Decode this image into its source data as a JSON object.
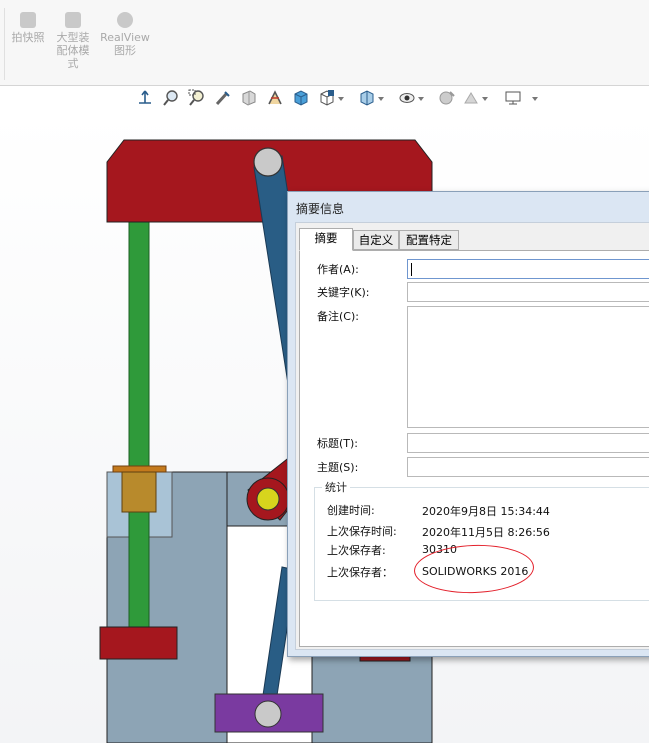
{
  "ribbon": {
    "items": [
      {
        "label": "拍快照",
        "icon": "camera-icon"
      },
      {
        "label": "大型装配体模式",
        "label_lines": [
          "大型装",
          "配体模",
          "式"
        ],
        "icon": "large-assembly-icon"
      },
      {
        "label": "RealView图形",
        "label_lines": [
          "RealView",
          "图形"
        ],
        "icon": "realview-icon"
      }
    ]
  },
  "view_toolbar": {
    "icons": [
      "view-orientation-icon",
      "zoom-to-fit-icon",
      "zoom-to-area-icon",
      "previous-view-icon",
      "section-view-icon",
      "dynamic-annotation-icon",
      "view-orientation-cube-icon",
      "display-style-icon",
      "hide-show-items-icon",
      "edit-appearance-icon",
      "apply-scene-icon",
      "view-settings-icon"
    ]
  },
  "dialog": {
    "title": "摘要信息",
    "tabs": [
      "摘要",
      "自定义",
      "配置特定"
    ],
    "active_tab": "摘要",
    "fields": {
      "author": {
        "label": "作者(A):",
        "value": ""
      },
      "keywords": {
        "label": "关键字(K):",
        "value": ""
      },
      "comments": {
        "label": "备注(C):",
        "value": ""
      },
      "title": {
        "label": "标题(T):",
        "value": ""
      },
      "subject": {
        "label": "主题(S):",
        "value": ""
      }
    },
    "stats": {
      "heading": "统计",
      "created_label": "创建时间:",
      "created_value": "2020年9月8日 15:34:44",
      "last_saved_label": "上次保存时间:",
      "last_saved_value": "2020年11月5日 8:26:56",
      "last_saved_by_label": "上次保存者:",
      "last_saved_by_value": "30310",
      "last_saved_with_label": "上次保存者：",
      "last_saved_with_value": "SOLIDWORKS 2016"
    }
  },
  "colors": {
    "top_block": "#a5171e",
    "green_rod": "#2f9a3a",
    "blue_link": "#295d85",
    "frame": "#8da4b5",
    "purple_block": "#7a3aa0",
    "yellow_pin": "#d7d51d",
    "annotation": "#e3202b"
  }
}
